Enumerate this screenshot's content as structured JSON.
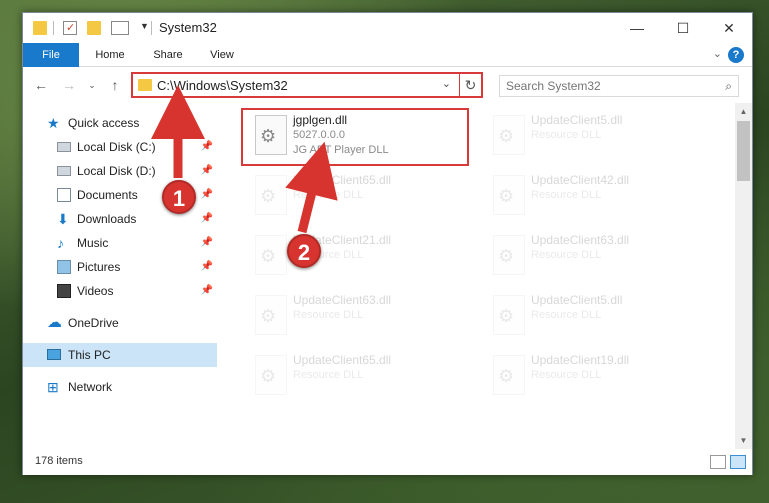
{
  "window": {
    "title": "System32"
  },
  "ribbon": {
    "tabs": [
      "File",
      "Home",
      "Share",
      "View"
    ],
    "help": "?"
  },
  "nav": {
    "address": "C:\\Windows\\System32",
    "search_placeholder": "Search System32"
  },
  "sidebar": {
    "items": [
      {
        "label": "Quick access",
        "icon": "star-icon",
        "pinned": false
      },
      {
        "label": "Local Disk (C:)",
        "icon": "drive-icon",
        "pinned": true
      },
      {
        "label": "Local Disk (D:)",
        "icon": "drive-icon",
        "pinned": true
      },
      {
        "label": "Documents",
        "icon": "documents-icon",
        "pinned": true
      },
      {
        "label": "Downloads",
        "icon": "download-icon",
        "pinned": true
      },
      {
        "label": "Music",
        "icon": "music-icon",
        "pinned": true
      },
      {
        "label": "Pictures",
        "icon": "pictures-icon",
        "pinned": true
      },
      {
        "label": "Videos",
        "icon": "videos-icon",
        "pinned": true
      },
      {
        "label": "OneDrive",
        "icon": "onedrive-icon",
        "pinned": false
      },
      {
        "label": "This PC",
        "icon": "pc-icon",
        "pinned": false,
        "selected": true
      },
      {
        "label": "Network",
        "icon": "network-icon",
        "pinned": false
      }
    ]
  },
  "files": [
    {
      "name": "jgplgen.dll",
      "line2": "5027.0.0.0",
      "line3": "JG ART Player DLL",
      "faded": false
    },
    {
      "name": "UpdateClient5.dll",
      "line2": "Resource DLL",
      "line3": "",
      "faded": true
    },
    {
      "name": "UpdateClient65.dll",
      "line2": "Resource DLL",
      "line3": "",
      "faded": true
    },
    {
      "name": "UpdateClient42.dll",
      "line2": "Resource DLL",
      "line3": "",
      "faded": true
    },
    {
      "name": "UpdateClient21.dll",
      "line2": "Resource DLL",
      "line3": "",
      "faded": true
    },
    {
      "name": "UpdateClient63.dll",
      "line2": "Resource DLL",
      "line3": "",
      "faded": true
    },
    {
      "name": "UpdateClient63.dll",
      "line2": "Resource DLL",
      "line3": "",
      "faded": true
    },
    {
      "name": "UpdateClient5.dll",
      "line2": "Resource DLL",
      "line3": "",
      "faded": true
    },
    {
      "name": "UpdateClient65.dll",
      "line2": "Resource DLL",
      "line3": "",
      "faded": true
    },
    {
      "name": "UpdateClient19.dll",
      "line2": "Resource DLL",
      "line3": "",
      "faded": true
    }
  ],
  "status": {
    "item_count": "178 items"
  },
  "annotations": {
    "step1": "1",
    "step2": "2",
    "color": "#d8342f"
  }
}
